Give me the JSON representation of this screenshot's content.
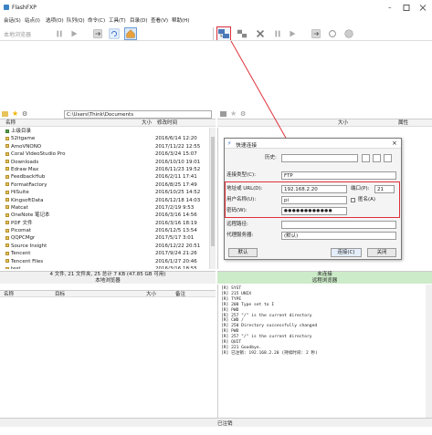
{
  "app": {
    "title": "FlashFXP"
  },
  "menu": [
    "会话(S)",
    "站点(I)",
    "选项(O)",
    "队列(Q)",
    "命令(C)",
    "工具(T)",
    "目录(D)",
    "查看(V)",
    "帮助(H)"
  ],
  "toolbar": {
    "left_label": "本地浏览器"
  },
  "left_pane": {
    "path": "C:\\Users\\Think\\Documents",
    "col_name": "名称",
    "col_size": "大小",
    "col_modified": "修改时间",
    "up_item": "上级目录",
    "files": [
      {
        "name": "52itgame",
        "date": "2016/6/14 12:20"
      },
      {
        "name": "AmoVNONO",
        "date": "2017/11/22 12:55"
      },
      {
        "name": "Coral VideoStudio Pro",
        "date": "2016/3/24 15:07"
      },
      {
        "name": "Downloads",
        "date": "2016/10/10 19:01"
      },
      {
        "name": "Edraw Max",
        "date": "2016/11/23 19:52"
      },
      {
        "name": "FeedbackHub",
        "date": "2016/2/11 17:41"
      },
      {
        "name": "FormatFactory",
        "date": "2016/8/25 17:49"
      },
      {
        "name": "HiSuite",
        "date": "2016/10/25 14:52"
      },
      {
        "name": "KingsoftData",
        "date": "2016/12/18 14:03"
      },
      {
        "name": "Matcat",
        "date": "2017/2/19 9:53"
      },
      {
        "name": "OneNote 笔记本",
        "date": "2016/3/16 14:56"
      },
      {
        "name": "PDF 文件",
        "date": "2016/3/16 18:19"
      },
      {
        "name": "Picomat",
        "date": "2016/12/5 13:54"
      },
      {
        "name": "QQPCMgr",
        "date": "2017/5/17 3:01"
      },
      {
        "name": "Source Insight",
        "date": "2016/12/22 20:51"
      },
      {
        "name": "Tencent",
        "date": "2017/9/24 21:26"
      },
      {
        "name": "Tencent Files",
        "date": "2016/1/27 20:46"
      },
      {
        "name": "test",
        "date": "2016/3/16 18:55"
      }
    ],
    "status": "4 文件, 21 文件夹, 25 总计 7 KB (47.85 GB 可用)",
    "status_sub": "本地浏览器"
  },
  "right_pane": {
    "col_size": "大小",
    "col_attr": "属性",
    "status": "未连接",
    "status_sub": "远程浏览器"
  },
  "queue": {
    "col_name": "名称",
    "col_target": "目标",
    "col_size": "大小",
    "col_remark": "备注"
  },
  "log_lines": [
    "[R] SYST",
    "[R] 215 UNIX",
    "[R] TYPE",
    "[R] 200 Type set to I",
    "[R] PWD",
    "[R] 257 \"/\" is the current directory",
    "[R] CWD /",
    "[R] 250 Directory successfully changed",
    "[R] PWD",
    "[R] 257 \"/\" is the current directory",
    "[R] QUIT",
    "[R] 221 Goodbye.",
    "[R] 已注销: 192.168.2.20 (持续时间: 2 秒)"
  ],
  "bottom_status": "已注销",
  "dialog": {
    "title": "快速连接",
    "history_label": "历史:",
    "history_value": "",
    "conntype_label": "连接类型(C):",
    "conntype_value": "FTP",
    "server_label": "地址或 URL(D):",
    "server_value": "192.168.2.20",
    "port_label": "端口(P):",
    "port_value": "21",
    "user_label": "用户名称(U):",
    "user_value": "pi",
    "anon_label": "匿名(A)",
    "pass_label": "密码(W):",
    "pass_value": "●●●●●●●●●●●●",
    "remote_label": "远程路径:",
    "remote_value": "",
    "proxy_label": "代理服务器:",
    "proxy_value": "(默认)",
    "default_btn": "默认",
    "connect_btn": "连接(C)",
    "close_btn": "关闭"
  },
  "colors": {
    "highlight_red": "#e0303a",
    "accent_blue": "#2a62c9"
  }
}
